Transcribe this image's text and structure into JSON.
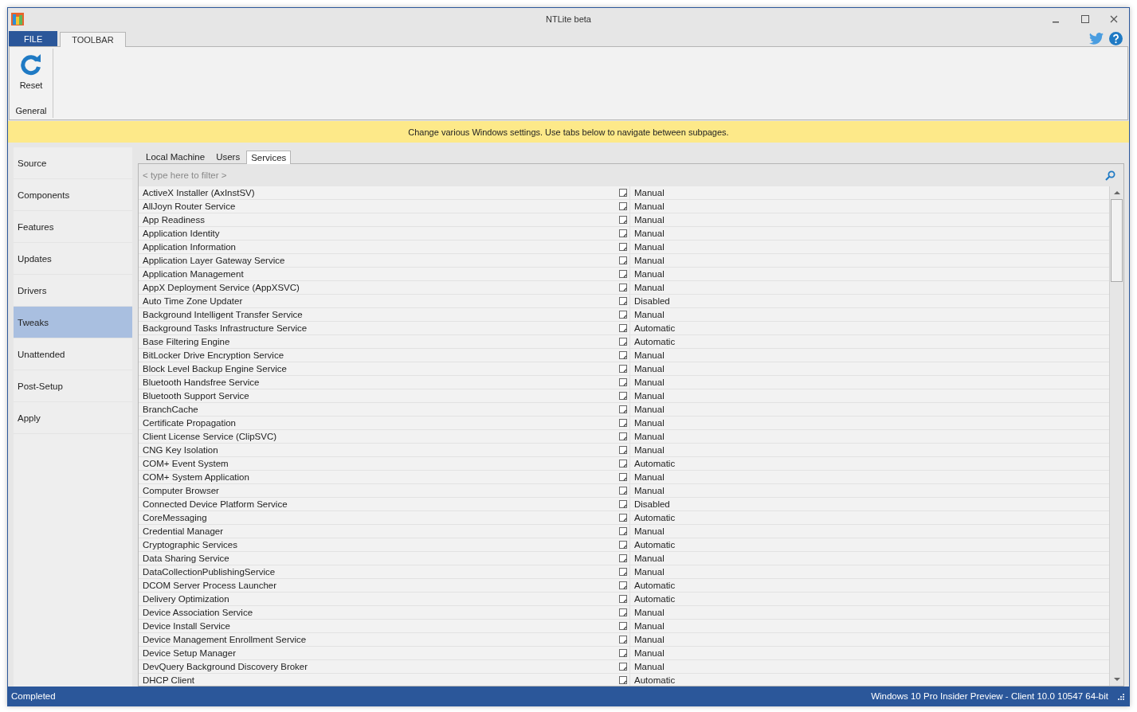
{
  "window": {
    "title": "NTLite beta"
  },
  "ribbon_tabs": [
    {
      "label": "FILE",
      "kind": "file",
      "selected": false
    },
    {
      "label": "TOOLBAR",
      "kind": "tab",
      "selected": true
    }
  ],
  "ribbon": {
    "buttons": [
      {
        "label": "Reset"
      }
    ],
    "group_label": "General"
  },
  "banner": "Change various Windows settings. Use tabs below to navigate between subpages.",
  "sidebar": {
    "items": [
      {
        "label": "Source",
        "selected": false
      },
      {
        "label": "Components",
        "selected": false
      },
      {
        "label": "Features",
        "selected": false
      },
      {
        "label": "Updates",
        "selected": false
      },
      {
        "label": "Drivers",
        "selected": false
      },
      {
        "label": "Tweaks",
        "selected": true
      },
      {
        "label": "Unattended",
        "selected": false
      },
      {
        "label": "Post-Setup",
        "selected": false
      },
      {
        "label": "Apply",
        "selected": false
      }
    ]
  },
  "subtabs": [
    {
      "label": "Local Machine",
      "selected": false
    },
    {
      "label": "Users",
      "selected": false
    },
    {
      "label": "Services",
      "selected": true
    }
  ],
  "filter": {
    "placeholder": "< type here to filter >"
  },
  "rows": [
    {
      "name": "ActiveX Installer (AxInstSV)",
      "checked": false,
      "startup": "Manual"
    },
    {
      "name": "AllJoyn Router Service",
      "checked": false,
      "startup": "Manual"
    },
    {
      "name": "App Readiness",
      "checked": false,
      "startup": "Manual"
    },
    {
      "name": "Application Identity",
      "checked": false,
      "startup": "Manual"
    },
    {
      "name": "Application Information",
      "checked": false,
      "startup": "Manual"
    },
    {
      "name": "Application Layer Gateway Service",
      "checked": false,
      "startup": "Manual"
    },
    {
      "name": "Application Management",
      "checked": false,
      "startup": "Manual"
    },
    {
      "name": "AppX Deployment Service (AppXSVC)",
      "checked": false,
      "startup": "Manual"
    },
    {
      "name": "Auto Time Zone Updater",
      "checked": false,
      "startup": "Disabled"
    },
    {
      "name": "Background Intelligent Transfer Service",
      "checked": false,
      "startup": "Manual"
    },
    {
      "name": "Background Tasks Infrastructure Service",
      "checked": false,
      "startup": "Automatic"
    },
    {
      "name": "Base Filtering Engine",
      "checked": false,
      "startup": "Automatic"
    },
    {
      "name": "BitLocker Drive Encryption Service",
      "checked": false,
      "startup": "Manual"
    },
    {
      "name": "Block Level Backup Engine Service",
      "checked": false,
      "startup": "Manual"
    },
    {
      "name": "Bluetooth Handsfree Service",
      "checked": false,
      "startup": "Manual"
    },
    {
      "name": "Bluetooth Support Service",
      "checked": false,
      "startup": "Manual"
    },
    {
      "name": "BranchCache",
      "checked": false,
      "startup": "Manual"
    },
    {
      "name": "Certificate Propagation",
      "checked": false,
      "startup": "Manual"
    },
    {
      "name": "Client License Service (ClipSVC)",
      "checked": false,
      "startup": "Manual"
    },
    {
      "name": "CNG Key Isolation",
      "checked": false,
      "startup": "Manual"
    },
    {
      "name": "COM+ Event System",
      "checked": false,
      "startup": "Automatic"
    },
    {
      "name": "COM+ System Application",
      "checked": false,
      "startup": "Manual"
    },
    {
      "name": "Computer Browser",
      "checked": false,
      "startup": "Manual"
    },
    {
      "name": "Connected Device Platform Service",
      "checked": false,
      "startup": "Disabled"
    },
    {
      "name": "CoreMessaging",
      "checked": false,
      "startup": "Automatic"
    },
    {
      "name": "Credential Manager",
      "checked": false,
      "startup": "Manual"
    },
    {
      "name": "Cryptographic Services",
      "checked": false,
      "startup": "Automatic"
    },
    {
      "name": "Data Sharing Service",
      "checked": false,
      "startup": "Manual"
    },
    {
      "name": "DataCollectionPublishingService",
      "checked": false,
      "startup": "Manual"
    },
    {
      "name": "DCOM Server Process Launcher",
      "checked": false,
      "startup": "Automatic"
    },
    {
      "name": "Delivery Optimization",
      "checked": false,
      "startup": "Automatic"
    },
    {
      "name": "Device Association Service",
      "checked": false,
      "startup": "Manual"
    },
    {
      "name": "Device Install Service",
      "checked": false,
      "startup": "Manual"
    },
    {
      "name": "Device Management Enrollment Service",
      "checked": false,
      "startup": "Manual"
    },
    {
      "name": "Device Setup Manager",
      "checked": false,
      "startup": "Manual"
    },
    {
      "name": "DevQuery Background Discovery Broker",
      "checked": false,
      "startup": "Manual"
    },
    {
      "name": "DHCP Client",
      "checked": false,
      "startup": "Automatic"
    }
  ],
  "status_bar": {
    "left": "Completed",
    "right": "Windows 10 Pro Insider Preview - Client 10.0 10547 64-bit"
  }
}
